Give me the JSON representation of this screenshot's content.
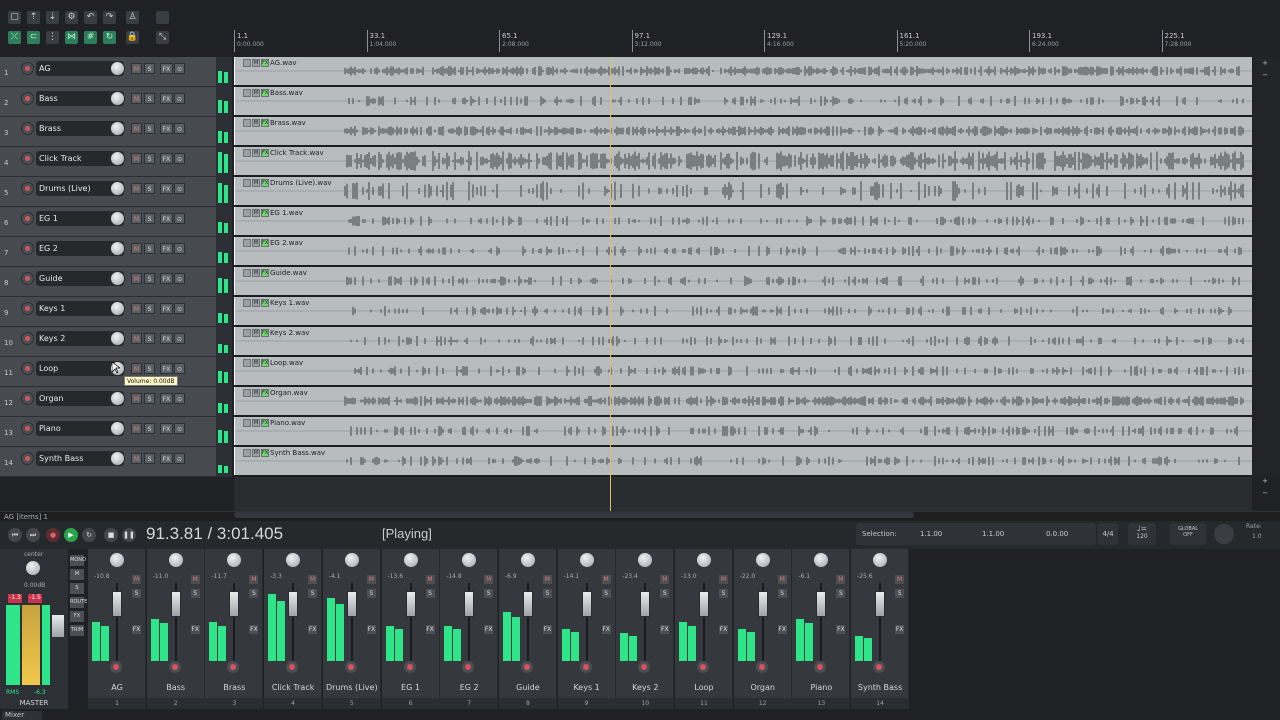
{
  "ruler": [
    {
      "measure": "1.1",
      "time": "0:00.000"
    },
    {
      "measure": "33.1",
      "time": "1:04.000"
    },
    {
      "measure": "65.1",
      "time": "2:08.000"
    },
    {
      "measure": "97.1",
      "time": "3:12.000"
    },
    {
      "measure": "129.1",
      "time": "4:16.000"
    },
    {
      "measure": "161.1",
      "time": "5:20.000"
    },
    {
      "measure": "193.1",
      "time": "6:24.000"
    },
    {
      "measure": "225.1",
      "time": "7:28.000"
    }
  ],
  "tracks": [
    {
      "num": "1",
      "name": "AG",
      "item": "AG.wav"
    },
    {
      "num": "2",
      "name": "Bass",
      "item": "Bass.wav"
    },
    {
      "num": "3",
      "name": "Brass",
      "item": "Brass.wav"
    },
    {
      "num": "4",
      "name": "Click Track",
      "item": "Click Track.wav"
    },
    {
      "num": "5",
      "name": "Drums (Live)",
      "item": "Drums (Live).wav"
    },
    {
      "num": "6",
      "name": "EG 1",
      "item": "EG 1.wav"
    },
    {
      "num": "7",
      "name": "EG 2",
      "item": "EG 2.wav"
    },
    {
      "num": "8",
      "name": "Guide",
      "item": "Guide.wav"
    },
    {
      "num": "9",
      "name": "Keys 1",
      "item": "Keys 1.wav"
    },
    {
      "num": "10",
      "name": "Keys 2",
      "item": "Keys 2.wav"
    },
    {
      "num": "11",
      "name": "Loop",
      "item": "Loop.wav"
    },
    {
      "num": "12",
      "name": "Organ",
      "item": "Organ.wav"
    },
    {
      "num": "13",
      "name": "Piano",
      "item": "Piano.wav"
    },
    {
      "num": "14",
      "name": "Synth Bass",
      "item": "Synth Bass.wav"
    }
  ],
  "track_buttons": {
    "mute": "M",
    "solo": "S",
    "fx": "FX",
    "io": "⊙"
  },
  "item_buttons": {
    "mute": "M",
    "fx": "FX"
  },
  "tooltip": "Volume: 0.00dB",
  "status": "AG [items] 1",
  "transport": {
    "position": "91.3.81 / 3:01.405",
    "state": "[Playing]",
    "selection_label": "Selection:",
    "sel_start": "1.1.00",
    "sel_end": "1.1.00",
    "sel_len": "0.0.00",
    "time_sig": "4/4",
    "tempo": "120",
    "global_label": "GLOBAL",
    "global_value": "OFF",
    "rate_label": "Rate:",
    "rate_value": "1.0"
  },
  "master": {
    "pan_label": "center",
    "vol": "0.00dB",
    "peak_l": "-1.3",
    "peak_r": "-1.5",
    "rms_label": "RMS",
    "rms_value": "-6.3",
    "name": "MASTER",
    "side_buttons": [
      "MONO",
      "M",
      "S",
      "ROUTE",
      "FX",
      "TRIM"
    ]
  },
  "mixer": [
    {
      "name": "AG",
      "num": "1",
      "vol": "-10.8",
      "lvl": 0.55
    },
    {
      "name": "Bass",
      "num": "2",
      "vol": "-11.0",
      "lvl": 0.6
    },
    {
      "name": "Brass",
      "num": "3",
      "vol": "-11.7",
      "lvl": 0.55
    },
    {
      "name": "Click Track",
      "num": "4",
      "vol": "-3.3",
      "lvl": 0.95
    },
    {
      "name": "Drums (Live)",
      "num": "5",
      "vol": "-4.1",
      "lvl": 0.9
    },
    {
      "name": "EG 1",
      "num": "6",
      "vol": "-13.6",
      "lvl": 0.5
    },
    {
      "name": "EG 2",
      "num": "7",
      "vol": "-14.8",
      "lvl": 0.5
    },
    {
      "name": "Guide",
      "num": "8",
      "vol": "-6.9",
      "lvl": 0.7
    },
    {
      "name": "Keys 1",
      "num": "9",
      "vol": "-14.1",
      "lvl": 0.45
    },
    {
      "name": "Keys 2",
      "num": "10",
      "vol": "-23.4",
      "lvl": 0.4
    },
    {
      "name": "Loop",
      "num": "11",
      "vol": "-13.0",
      "lvl": 0.55
    },
    {
      "name": "Organ",
      "num": "12",
      "vol": "-22.0",
      "lvl": 0.45
    },
    {
      "name": "Piano",
      "num": "13",
      "vol": "-6.1",
      "lvl": 0.6
    },
    {
      "name": "Synth Bass",
      "num": "14",
      "vol": "-25.6",
      "lvl": 0.35
    }
  ],
  "mixer_buttons": {
    "m": "M",
    "s": "S",
    "fx": "FX"
  },
  "mixer_tab": "Mixer",
  "colors": {
    "meter": "#2ee58a",
    "playhead": "#d9c26a",
    "item_bg": "#b8bcbe",
    "rec": "#d7535d"
  }
}
